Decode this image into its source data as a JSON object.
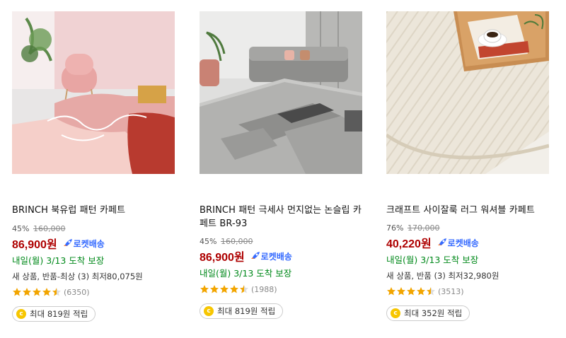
{
  "products": [
    {
      "title": "BRINCH 북유럽 패턴 카페트",
      "discount": "45%",
      "original_price": "160,000",
      "price": "86,900원",
      "rocket_label": "로켓배송",
      "delivery": "내일(월) 3/13 도착 보장",
      "extra": "새 상품, 반품-최상 (3) 최저80,075원",
      "rating": 4.5,
      "rating_count": "(6350)",
      "coin_symbol": "c",
      "reward": "최대 819원 적립"
    },
    {
      "title": "BRINCH 패턴 극세사 먼지없는 논슬립 카페트 BR-93",
      "discount": "45%",
      "original_price": "160,000",
      "price": "86,900원",
      "rocket_label": "로켓배송",
      "delivery": "내일(월) 3/13 도착 보장",
      "rating": 4.5,
      "rating_count": "(1988)",
      "coin_symbol": "c",
      "reward": "최대 819원 적립"
    },
    {
      "title": "크래프트 사이잘룩 러그 워셔블 카페트",
      "discount": "76%",
      "original_price": "170,000",
      "price": "40,220원",
      "rocket_label": "로켓배송",
      "delivery": "내일(월) 3/13 도착 보장",
      "extra": "새 상품, 반품 (3) 최저32,980원",
      "rating": 4.5,
      "rating_count": "(3513)",
      "coin_symbol": "c",
      "reward": "최대 352원 적립"
    }
  ],
  "colors": {
    "price": "#ae0000",
    "rocket": "#346aff",
    "delivery": "#00891a",
    "star": "#f2a500"
  },
  "icons": {
    "rocket": "rocket-icon",
    "star": "star-icon",
    "coin": "coin-icon"
  }
}
